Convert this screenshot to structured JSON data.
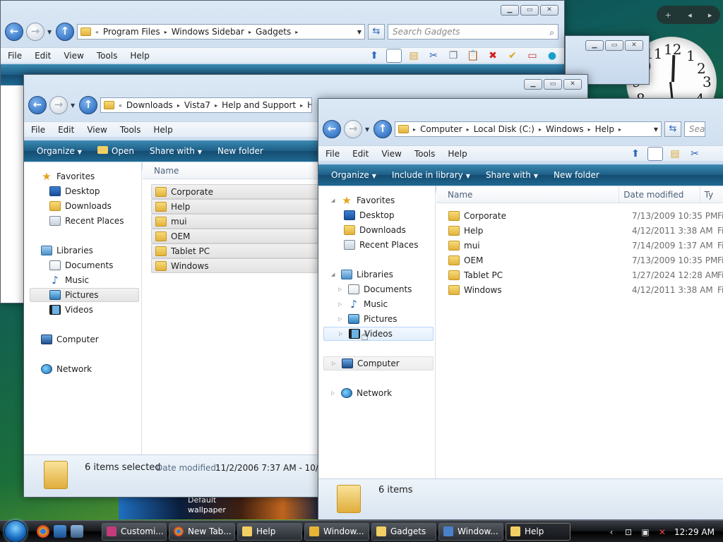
{
  "desktop": {
    "gadget_controls": [
      "+",
      "◂",
      "▸"
    ],
    "clock": {
      "numbers": [
        "12",
        "1",
        "2",
        "3",
        "4",
        "8",
        "9",
        "10",
        "11"
      ]
    },
    "wallpaper_label": "Default wallpaper"
  },
  "window_gadgets": {
    "breadcrumb": [
      "Program Files",
      "Windows Sidebar",
      "Gadgets"
    ],
    "search_placeholder": "Search Gadgets",
    "menu": [
      "File",
      "Edit",
      "View",
      "Tools",
      "Help"
    ],
    "caption": {
      "min": "▁",
      "max": "▭",
      "close": "✕"
    }
  },
  "window_vista7": {
    "breadcrumb": [
      "Downloads",
      "Vista7",
      "Help and Support",
      "He"
    ],
    "menu": [
      "File",
      "Edit",
      "View",
      "Tools",
      "Help"
    ],
    "commands": [
      "Organize",
      "Open",
      "Share with",
      "New folder"
    ],
    "nav": {
      "favorites": "Favorites",
      "favorites_items": [
        "Desktop",
        "Downloads",
        "Recent Places"
      ],
      "libraries": "Libraries",
      "libraries_items": [
        "Documents",
        "Music",
        "Pictures",
        "Videos"
      ],
      "computer": "Computer",
      "network": "Network"
    },
    "column_name": "Name",
    "files": [
      "Corporate",
      "Help",
      "mui",
      "OEM",
      "Tablet PC",
      "Windows"
    ],
    "status": {
      "count": "6 items selected",
      "modified_label": "Date modified:",
      "modified_value": "11/2/2006 7:37 AM - 10/6/2"
    }
  },
  "window_help": {
    "breadcrumb": [
      "Computer",
      "Local Disk (C:)",
      "Windows",
      "Help"
    ],
    "search_placeholder": "Sea",
    "menu": [
      "File",
      "Edit",
      "View",
      "Tools",
      "Help"
    ],
    "commands": [
      "Organize",
      "Include in library",
      "Share with",
      "New folder"
    ],
    "nav": {
      "favorites": "Favorites",
      "favorites_items": [
        "Desktop",
        "Downloads",
        "Recent Places"
      ],
      "libraries": "Libraries",
      "libraries_items": [
        "Documents",
        "Music",
        "Pictures",
        "Videos"
      ],
      "computer": "Computer",
      "network": "Network"
    },
    "columns": [
      "Name",
      "Date modified",
      "Ty"
    ],
    "files": [
      {
        "name": "Corporate",
        "date": "7/13/2009 10:35 PM",
        "type": "Fi"
      },
      {
        "name": "Help",
        "date": "4/12/2011 3:38 AM",
        "type": "Fi"
      },
      {
        "name": "mui",
        "date": "7/14/2009 1:37 AM",
        "type": "Fi"
      },
      {
        "name": "OEM",
        "date": "7/13/2009 10:35 PM",
        "type": "Fi"
      },
      {
        "name": "Tablet PC",
        "date": "1/27/2024 12:28 AM",
        "type": "Fi"
      },
      {
        "name": "Windows",
        "date": "4/12/2011 3:38 AM",
        "type": "Fi"
      }
    ],
    "status": {
      "count": "6 items"
    }
  },
  "taskbar": {
    "tasks": [
      "Customi...",
      "New Tab...",
      "Help",
      "Window...",
      "Gadgets",
      "Window...",
      "Help"
    ],
    "time": "12:29 AM"
  }
}
